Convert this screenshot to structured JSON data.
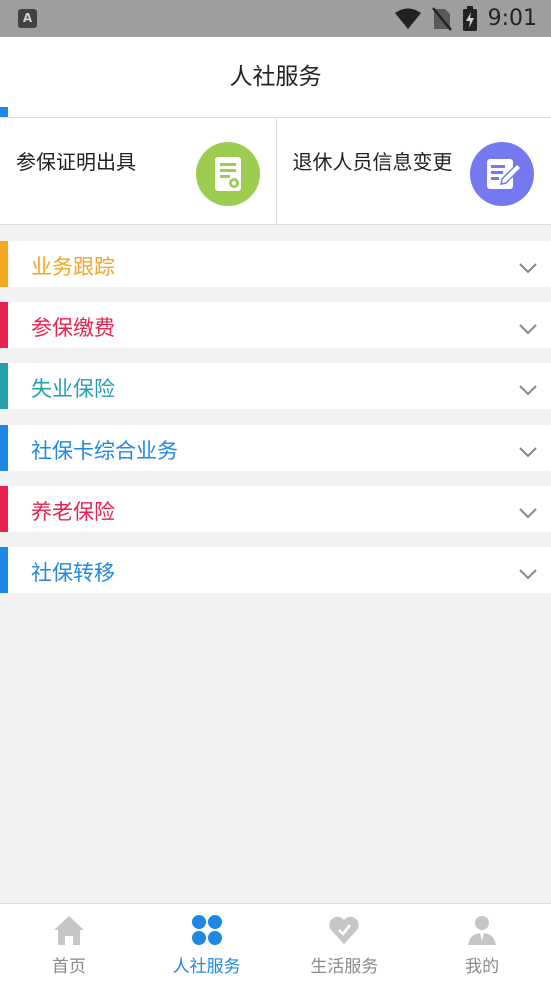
{
  "status_bar": {
    "app_icon_letter": "A",
    "time": "9:01"
  },
  "header": {
    "title": "人社服务"
  },
  "quick_actions": [
    {
      "label": "参保证明出具",
      "icon": "document-certificate-icon",
      "color": "#9ccc50"
    },
    {
      "label": "退休人员信息变更",
      "icon": "edit-note-icon",
      "color": "#7479f0"
    }
  ],
  "sections": [
    {
      "label": "业务跟踪",
      "color": "#f5a623"
    },
    {
      "label": "参保缴费",
      "color": "#e8234f"
    },
    {
      "label": "失业保险",
      "color": "#26a0ad"
    },
    {
      "label": "社保卡综合业务",
      "color": "#1e88e5"
    },
    {
      "label": "养老保险",
      "color": "#e8234f"
    },
    {
      "label": "社保转移",
      "color": "#1e88e5"
    }
  ],
  "tab_bar": {
    "tabs": [
      {
        "label": "首页",
        "icon": "home-icon",
        "active": false
      },
      {
        "label": "人社服务",
        "icon": "clover-icon",
        "active": true
      },
      {
        "label": "生活服务",
        "icon": "heart-icon",
        "active": false
      },
      {
        "label": "我的",
        "icon": "person-icon",
        "active": false
      }
    ]
  },
  "colors": {
    "accent": "#1e88e5",
    "inactive_tab": "#8a8a8a",
    "background": "#f2f2f2"
  }
}
